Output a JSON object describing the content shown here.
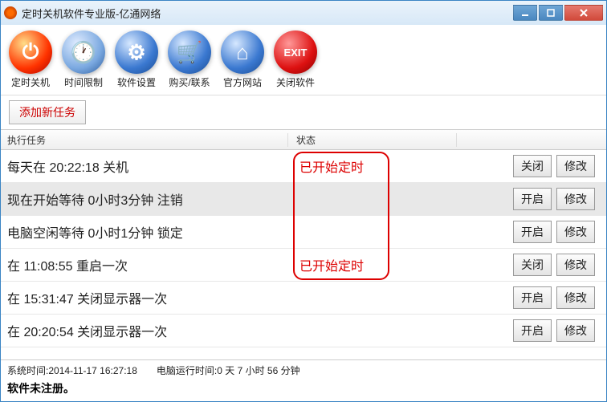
{
  "titlebar": {
    "title": "定时关机软件专业版-亿通网络"
  },
  "toolbar": [
    {
      "label": "定时关机",
      "name": "tool-shutdown",
      "icon": "power-icon",
      "iconClass": "icon-power",
      "glyph": "⏻"
    },
    {
      "label": "时间限制",
      "name": "tool-timelimit",
      "icon": "clock-icon",
      "iconClass": "icon-clock",
      "glyph": "🕐"
    },
    {
      "label": "软件设置",
      "name": "tool-settings",
      "icon": "gear-icon",
      "iconClass": "icon-gear",
      "glyph": "⚙"
    },
    {
      "label": "购买/联系",
      "name": "tool-buy",
      "icon": "cart-icon",
      "iconClass": "icon-cart",
      "glyph": "🛒"
    },
    {
      "label": "官方网站",
      "name": "tool-website",
      "icon": "home-icon",
      "iconClass": "icon-home",
      "glyph": "⌂"
    },
    {
      "label": "关闭软件",
      "name": "tool-exit",
      "icon": "exit-icon",
      "iconClass": "icon-exit",
      "glyph": "EXIT"
    }
  ],
  "subbar": {
    "addTask": "添加新任务"
  },
  "headers": {
    "task": "执行任务",
    "status": "状态"
  },
  "buttons": {
    "close": "关闭",
    "open": "开启",
    "modify": "修改"
  },
  "rows": [
    {
      "task": "每天在 20:22:18 关机",
      "status": "已开始定时",
      "toggle": "close",
      "selected": false
    },
    {
      "task": "现在开始等待 0小时3分钟 注销",
      "status": "",
      "toggle": "open",
      "selected": true
    },
    {
      "task": "电脑空闲等待 0小时1分钟 锁定",
      "status": "",
      "toggle": "open",
      "selected": false
    },
    {
      "task": "在 11:08:55 重启一次",
      "status": "已开始定时",
      "toggle": "close",
      "selected": false
    },
    {
      "task": "在 15:31:47 关闭显示器一次",
      "status": "",
      "toggle": "open",
      "selected": false
    },
    {
      "task": "在 20:20:54 关闭显示器一次",
      "status": "",
      "toggle": "open",
      "selected": false
    }
  ],
  "footer": {
    "systime_label": "系统时间:",
    "systime_value": "2014-11-17 16:27:18",
    "uptime_label": "电脑运行时间:",
    "uptime_value": "0 天 7 小时 56 分钟",
    "register": "软件未注册。"
  }
}
